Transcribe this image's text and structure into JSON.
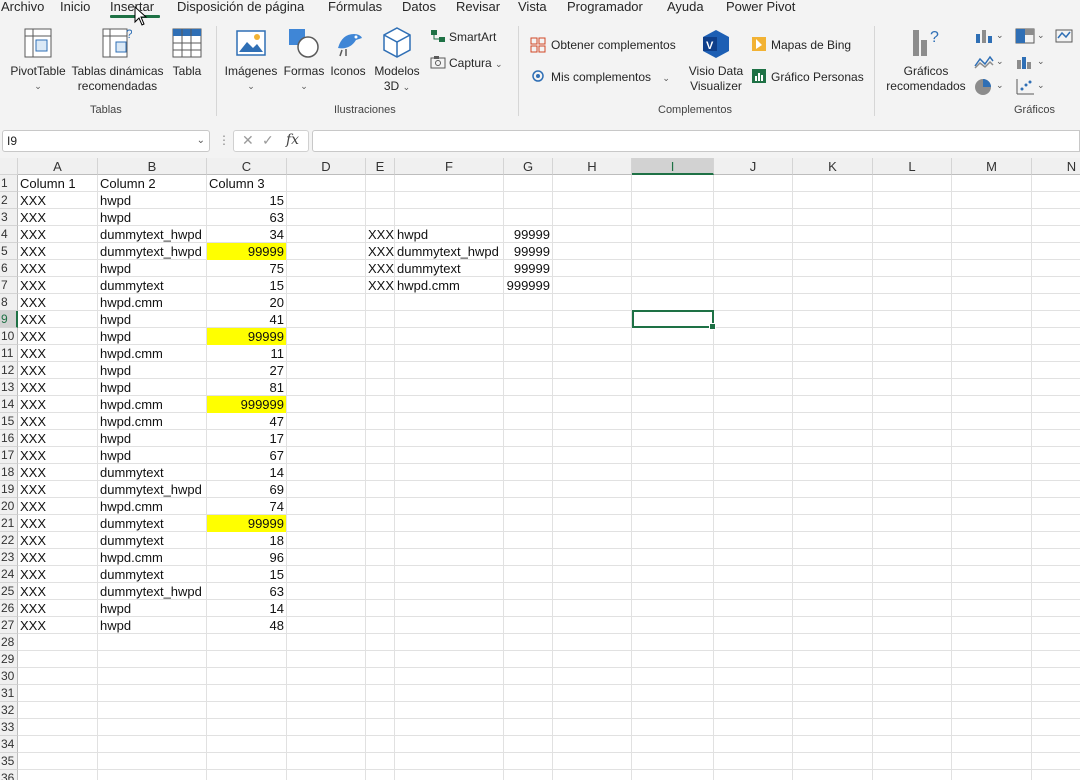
{
  "menu_tabs": [
    "Archivo",
    "Inicio",
    "Insertar",
    "Disposición de página",
    "Fórmulas",
    "Datos",
    "Revisar",
    "Vista",
    "Programador",
    "Ayuda",
    "Power Pivot"
  ],
  "ribbon": {
    "tablas": {
      "pivottable": "PivotTable",
      "recomendadas_1": "Tablas dinámicas",
      "recomendadas_2": "recomendadas",
      "tabla": "Tabla",
      "label": "Tablas"
    },
    "ilustraciones": {
      "imagenes": "Imágenes",
      "formas": "Formas",
      "iconos": "Iconos",
      "modelos_1": "Modelos",
      "modelos_2": "3D",
      "smartart": "SmartArt",
      "captura": "Captura",
      "label": "Ilustraciones"
    },
    "complementos": {
      "obtener": "Obtener complementos",
      "mis": "Mis complementos",
      "visio_1": "Visio Data",
      "visio_2": "Visualizer",
      "bing": "Mapas de Bing",
      "personas": "Gráfico Personas",
      "label": "Complementos"
    },
    "graficos": {
      "recomendados_1": "Gráficos",
      "recomendados_2": "recomendados",
      "label": "Gráficos"
    }
  },
  "formula_bar": {
    "name_box": "I9",
    "fx": "fx",
    "value": ""
  },
  "columns": [
    "A",
    "B",
    "C",
    "D",
    "E",
    "F",
    "G",
    "H",
    "I",
    "J",
    "K",
    "L",
    "M",
    "N"
  ],
  "rows": [
    "1",
    "2",
    "3",
    "4",
    "5",
    "6",
    "7",
    "8",
    "9",
    "10",
    "11",
    "12",
    "13",
    "14",
    "15",
    "16",
    "17",
    "18",
    "19",
    "20",
    "21",
    "22",
    "23",
    "24",
    "25",
    "26",
    "27",
    "28",
    "29",
    "30",
    "31",
    "32",
    "33",
    "34",
    "35",
    "36"
  ],
  "table": {
    "header": [
      "Column 1",
      "Column 2",
      "Column 3"
    ],
    "rows": [
      [
        "XXX",
        "hwpd",
        "15"
      ],
      [
        "XXX",
        "hwpd",
        "63"
      ],
      [
        "XXX",
        "dummytext_hwpd",
        "34"
      ],
      [
        "XXX",
        "dummytext_hwpd",
        "99999"
      ],
      [
        "XXX",
        "hwpd",
        "75"
      ],
      [
        "XXX",
        "dummytext",
        "15"
      ],
      [
        "XXX",
        "hwpd.cmm",
        "20"
      ],
      [
        "XXX",
        "hwpd",
        "41"
      ],
      [
        "XXX",
        "hwpd",
        "99999"
      ],
      [
        "XXX",
        "hwpd.cmm",
        "11"
      ],
      [
        "XXX",
        "hwpd",
        "27"
      ],
      [
        "XXX",
        "hwpd",
        "81"
      ],
      [
        "XXX",
        "hwpd.cmm",
        "999999"
      ],
      [
        "XXX",
        "hwpd.cmm",
        "47"
      ],
      [
        "XXX",
        "hwpd",
        "17"
      ],
      [
        "XXX",
        "hwpd",
        "67"
      ],
      [
        "XXX",
        "dummytext",
        "14"
      ],
      [
        "XXX",
        "dummytext_hwpd",
        "69"
      ],
      [
        "XXX",
        "hwpd.cmm",
        "74"
      ],
      [
        "XXX",
        "dummytext",
        "99999"
      ],
      [
        "XXX",
        "dummytext",
        "18"
      ],
      [
        "XXX",
        "hwpd.cmm",
        "96"
      ],
      [
        "XXX",
        "dummytext",
        "15"
      ],
      [
        "XXX",
        "dummytext_hwpd",
        "63"
      ],
      [
        "XXX",
        "hwpd",
        "14"
      ],
      [
        "XXX",
        "hwpd",
        "48"
      ]
    ],
    "highlighted_rows": [
      3,
      8,
      12,
      19
    ],
    "highlight_color": "#ffff00"
  },
  "lookup_table": [
    [
      "XXX",
      "hwpd",
      "99999"
    ],
    [
      "XXX",
      "dummytext_hwpd",
      "99999"
    ],
    [
      "XXX",
      "dummytext",
      "99999"
    ],
    [
      "XXX",
      "hwpd.cmm",
      "999999"
    ]
  ],
  "selected_cell": "I9",
  "accent_color": "#1e7145"
}
